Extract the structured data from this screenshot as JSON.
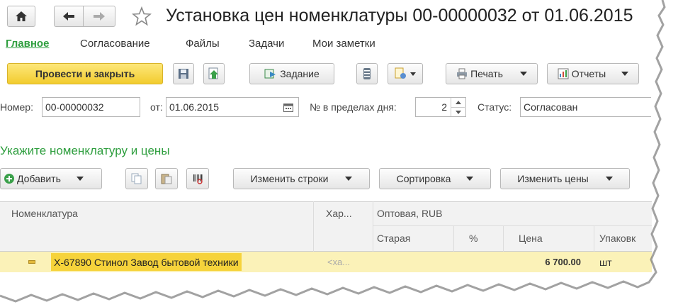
{
  "window": {
    "title": "Установка цен номенклатуры 00-00000032 от 01.06.2015"
  },
  "tabs": [
    {
      "label": "Главное",
      "active": true
    },
    {
      "label": "Согласование"
    },
    {
      "label": "Файлы"
    },
    {
      "label": "Задачи"
    },
    {
      "label": "Мои заметки"
    }
  ],
  "toolbar": {
    "post_close_label": "Провести и закрыть",
    "task_label": "Задание",
    "print_label": "Печать",
    "reports_label": "Отчеты"
  },
  "form": {
    "number_label": "Номер:",
    "number_value": "00-00000032",
    "date_label": "от:",
    "date_value": "01.06.2015",
    "day_seq_label": "№ в пределах дня:",
    "day_seq_value": "2",
    "status_label": "Статус:",
    "status_value": "Согласован"
  },
  "section": {
    "title": "Укажите номенклатуру и цены"
  },
  "table_toolbar": {
    "add_label": "Добавить",
    "change_rows_label": "Изменить строки",
    "sort_label": "Сортировка",
    "change_prices_label": "Изменить цены"
  },
  "table": {
    "col_item": "Номенклатура",
    "col_char": "Хар...",
    "group_wholesale": "Оптовая, RUB",
    "col_old": "Старая",
    "col_pct": "%",
    "col_price": "Цена",
    "col_pack": "Упаковк",
    "rows": [
      {
        "item": "X-67890 Стинол Завод бытовой техники",
        "char": "<ха...",
        "old": "",
        "pct": "",
        "price": "6 700.00",
        "pack": "шт"
      }
    ]
  },
  "colors": {
    "accent_green": "#2e9e3e",
    "primary_button": "#f7d64a",
    "row_highlight": "#fbf2b8",
    "selected_cell": "#f6d33b"
  }
}
